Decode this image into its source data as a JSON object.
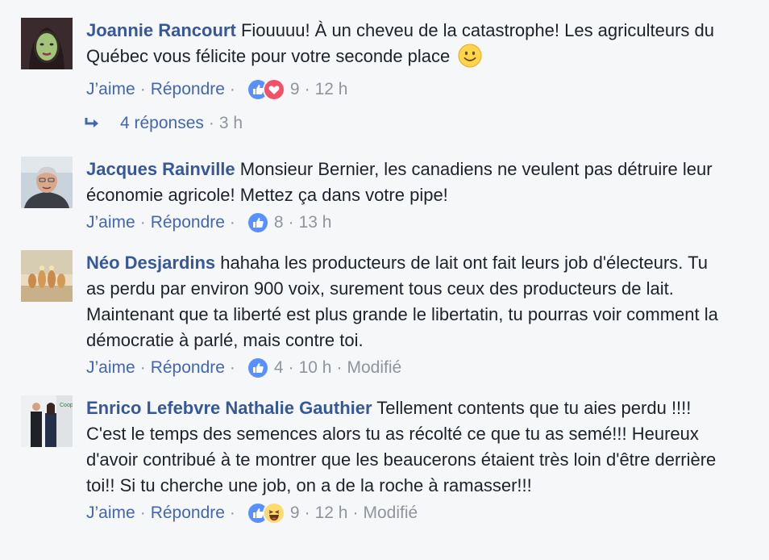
{
  "comments": [
    {
      "author": "Joannie Rancourt",
      "text": "Fiouuuu! À un cheveu de la catastrophe! Les agriculteurs du Québec vous félicite pour votre seconde place",
      "emoji": "slightly-smiling-face",
      "like_label": "J’aime",
      "reply_label": "Répondre",
      "reactions": [
        "like",
        "love"
      ],
      "reaction_count": "9",
      "time": "12 h"
    },
    {
      "author": "Jacques Rainville",
      "text": "Monsieur Bernier, les canadiens ne veulent pas détruire leur économie agricole! Mettez ça dans votre pipe!",
      "like_label": "J’aime",
      "reply_label": "Répondre",
      "reactions": [
        "like"
      ],
      "reaction_count": "8",
      "time": "13 h"
    },
    {
      "author": "Néo Desjardins",
      "text": "hahaha les producteurs de lait ont fait leurs job d'électeurs. Tu as perdu par environ 900 voix, surement tous ceux des producteurs de lait. Maintenant que ta liberté est plus grande le libertatin, tu pourras voir comment la démocratie à parlé, mais contre toi.",
      "like_label": "J’aime",
      "reply_label": "Répondre",
      "reactions": [
        "like"
      ],
      "reaction_count": "4",
      "time": "10 h",
      "edited": "Modifié"
    },
    {
      "author": "Enrico Lefebvre Nathalie Gauthier",
      "text": "Tellement contents que tu aies perdu !!!! C'est le temps des semences alors tu as récolté ce que tu as semé!!! Heureux d'avoir contribué à te montrer que les beaucerons étaient très loin d'être derrière toi!! Si tu cherche une job, on a de la roche à ramasser!!!",
      "like_label": "J’aime",
      "reply_label": "Répondre",
      "reactions": [
        "like",
        "haha"
      ],
      "reaction_count": "9",
      "time": "12 h",
      "edited": "Modifié"
    }
  ],
  "replies_link": {
    "label": "4 réponses",
    "time": "3 h"
  },
  "colors": {
    "author": "#365899",
    "link": "#4267b2",
    "meta": "#90949c",
    "text": "#1d2129",
    "background": "#f6f7f9",
    "like": "#5890ff",
    "love": "#f25268",
    "haha": "#ffd972"
  }
}
